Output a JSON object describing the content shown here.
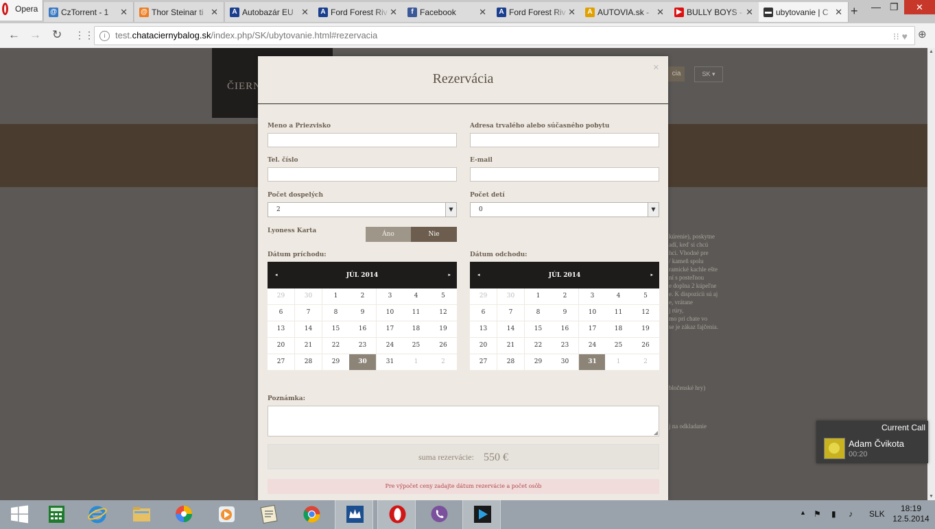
{
  "browser": {
    "menu_label": "Opera",
    "tabs": [
      {
        "title": "CzTorrent - 1",
        "color": "#3a79c2",
        "glyph": "@"
      },
      {
        "title": "Thor Steinar ti",
        "color": "#ee7d22",
        "glyph": "@"
      },
      {
        "title": "Autobazár EU",
        "color": "#1b3f8f",
        "glyph": "A"
      },
      {
        "title": "Ford Forest Riv",
        "color": "#1b3f8f",
        "glyph": "A"
      },
      {
        "title": "Facebook",
        "color": "#3b5998",
        "glyph": "f"
      },
      {
        "title": "Ford Forest Riv",
        "color": "#1b3f8f",
        "glyph": "A"
      },
      {
        "title": "AUTOVIA.sk -",
        "color": "#e0a000",
        "glyph": "A"
      },
      {
        "title": "BULLY BOYS -",
        "color": "#d11",
        "glyph": "▶"
      },
      {
        "title": "ubytovanie | C",
        "color": "#333",
        "glyph": "▬"
      }
    ],
    "url_prefix": "test.",
    "url_host": "chataciernybalog.sk",
    "url_path": "/index.php/SK/ubytovanie.html#rezervacia"
  },
  "background_page": {
    "logo_text": "ČIERN",
    "menu_btn": "cia",
    "lang": "SK",
    "text_lines": [
      "kúrenie), poskytne",
      "adí, keď si chcú",
      "hci. Vhodné pre",
      "/ kameň spolu",
      "ramické kachle ešte",
      "ní s posteľnou",
      "e doplna 2 kúpeľne",
      "e. K dispozícii sú aj",
      "e, vrátane",
      "j rúry,",
      "mo pri chate vo",
      "se je zákaz fajčenia.",
      "bločenské hry)",
      "j na odkladanie"
    ]
  },
  "modal": {
    "title": "Rezervácia",
    "close_glyph": "×",
    "fields": {
      "name_label": "Meno a Priezvisko",
      "address_label": "Adresa trvalého alebo súčasného pobytu",
      "phone_label": "Tel. číslo",
      "email_label": "E-mail",
      "adults_label": "Počet dospelých",
      "adults_value": "2",
      "children_label": "Počet detí",
      "children_value": "0",
      "lyoness_label": "Lyoness Karta",
      "lyoness_yes": "Áno",
      "lyoness_no": "Nie",
      "lyoness_selected": "Nie",
      "arrival_label": "Dátum príchodu:",
      "departure_label": "Dátum odchodu:",
      "note_label": "Poznámka:"
    },
    "calendars": [
      {
        "month": "JÚL 2014",
        "prev": "◂",
        "next": "▸",
        "days": [
          "29",
          "30",
          "1",
          "2",
          "3",
          "4",
          "5",
          "6",
          "7",
          "8",
          "9",
          "10",
          "11",
          "12",
          "13",
          "14",
          "15",
          "16",
          "17",
          "18",
          "19",
          "20",
          "21",
          "22",
          "23",
          "24",
          "25",
          "26",
          "27",
          "28",
          "29",
          "30",
          "31",
          "1",
          "2"
        ],
        "other_month": [
          0,
          1,
          33,
          34
        ],
        "selected": 31
      },
      {
        "month": "JÚL 2014",
        "prev": "◂",
        "next": "▸",
        "days": [
          "29",
          "30",
          "1",
          "2",
          "3",
          "4",
          "5",
          "6",
          "7",
          "8",
          "9",
          "10",
          "11",
          "12",
          "13",
          "14",
          "15",
          "16",
          "17",
          "18",
          "19",
          "20",
          "21",
          "22",
          "23",
          "24",
          "25",
          "26",
          "27",
          "28",
          "29",
          "30",
          "31",
          "1",
          "2"
        ],
        "other_month": [
          0,
          1,
          33,
          34
        ],
        "selected": 32
      }
    ],
    "sum_label": "suma rezervácie:",
    "sum_value": "550 €",
    "warning": "Pre výpočet ceny zadajte dátum rezervácie a počet osôb"
  },
  "notification": {
    "header": "Current Call",
    "name": "Adam Čvikota",
    "time": "00:20"
  },
  "taskbar": {
    "lang": "SLK",
    "time": "18:19",
    "date": "12.5.2014"
  }
}
